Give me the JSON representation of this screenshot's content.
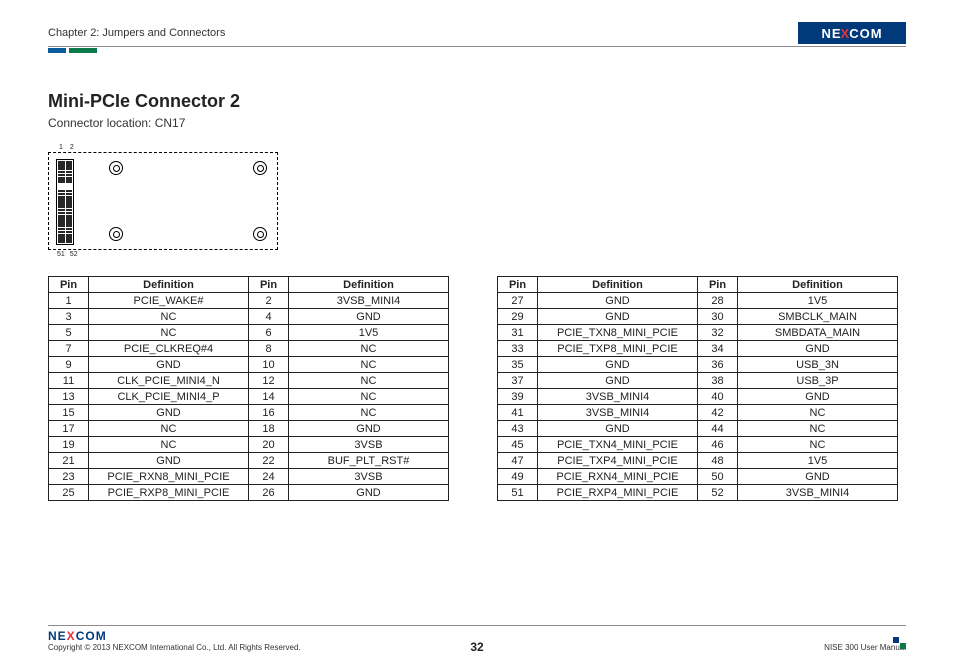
{
  "header": {
    "chapter": "Chapter 2: Jumpers and Connectors",
    "logo_text_pre": "NE",
    "logo_text_x": "X",
    "logo_text_post": "COM"
  },
  "section": {
    "title": "Mini-PCIe Connector 2",
    "subtitle": "Connector location: CN17"
  },
  "diagram_labels": {
    "top_left": "1",
    "top_right": "2",
    "bot_left": "51",
    "bot_right": "52"
  },
  "columns": {
    "pin": "Pin",
    "def": "Definition"
  },
  "table_left": [
    {
      "p1": "1",
      "d1": "PCIE_WAKE#",
      "p2": "2",
      "d2": "3VSB_MINI4"
    },
    {
      "p1": "3",
      "d1": "NC",
      "p2": "4",
      "d2": "GND"
    },
    {
      "p1": "5",
      "d1": "NC",
      "p2": "6",
      "d2": "1V5"
    },
    {
      "p1": "7",
      "d1": "PCIE_CLKREQ#4",
      "p2": "8",
      "d2": "NC"
    },
    {
      "p1": "9",
      "d1": "GND",
      "p2": "10",
      "d2": "NC"
    },
    {
      "p1": "11",
      "d1": "CLK_PCIE_MINI4_N",
      "p2": "12",
      "d2": "NC"
    },
    {
      "p1": "13",
      "d1": "CLK_PCIE_MINI4_P",
      "p2": "14",
      "d2": "NC"
    },
    {
      "p1": "15",
      "d1": "GND",
      "p2": "16",
      "d2": "NC"
    },
    {
      "p1": "17",
      "d1": "NC",
      "p2": "18",
      "d2": "GND"
    },
    {
      "p1": "19",
      "d1": "NC",
      "p2": "20",
      "d2": "3VSB"
    },
    {
      "p1": "21",
      "d1": "GND",
      "p2": "22",
      "d2": "BUF_PLT_RST#"
    },
    {
      "p1": "23",
      "d1": "PCIE_RXN8_MINI_PCIE",
      "p2": "24",
      "d2": "3VSB"
    },
    {
      "p1": "25",
      "d1": "PCIE_RXP8_MINI_PCIE",
      "p2": "26",
      "d2": "GND"
    }
  ],
  "table_right": [
    {
      "p1": "27",
      "d1": "GND",
      "p2": "28",
      "d2": "1V5"
    },
    {
      "p1": "29",
      "d1": "GND",
      "p2": "30",
      "d2": "SMBCLK_MAIN"
    },
    {
      "p1": "31",
      "d1": "PCIE_TXN8_MINI_PCIE",
      "p2": "32",
      "d2": "SMBDATA_MAIN"
    },
    {
      "p1": "33",
      "d1": "PCIE_TXP8_MINI_PCIE",
      "p2": "34",
      "d2": "GND"
    },
    {
      "p1": "35",
      "d1": "GND",
      "p2": "36",
      "d2": "USB_3N"
    },
    {
      "p1": "37",
      "d1": "GND",
      "p2": "38",
      "d2": "USB_3P"
    },
    {
      "p1": "39",
      "d1": "3VSB_MINI4",
      "p2": "40",
      "d2": "GND"
    },
    {
      "p1": "41",
      "d1": "3VSB_MINI4",
      "p2": "42",
      "d2": "NC"
    },
    {
      "p1": "43",
      "d1": "GND",
      "p2": "44",
      "d2": "NC"
    },
    {
      "p1": "45",
      "d1": "PCIE_TXN4_MINI_PCIE",
      "p2": "46",
      "d2": "NC"
    },
    {
      "p1": "47",
      "d1": "PCIE_TXP4_MINI_PCIE",
      "p2": "48",
      "d2": "1V5"
    },
    {
      "p1": "49",
      "d1": "PCIE_RXN4_MINI_PCIE",
      "p2": "50",
      "d2": "GND"
    },
    {
      "p1": "51",
      "d1": "PCIE_RXP4_MINI_PCIE",
      "p2": "52",
      "d2": "3VSB_MINI4"
    }
  ],
  "footer": {
    "copyright": "Copyright © 2013 NEXCOM International Co., Ltd. All Rights Reserved.",
    "page": "32",
    "manual": "NISE 300 User Manual"
  }
}
